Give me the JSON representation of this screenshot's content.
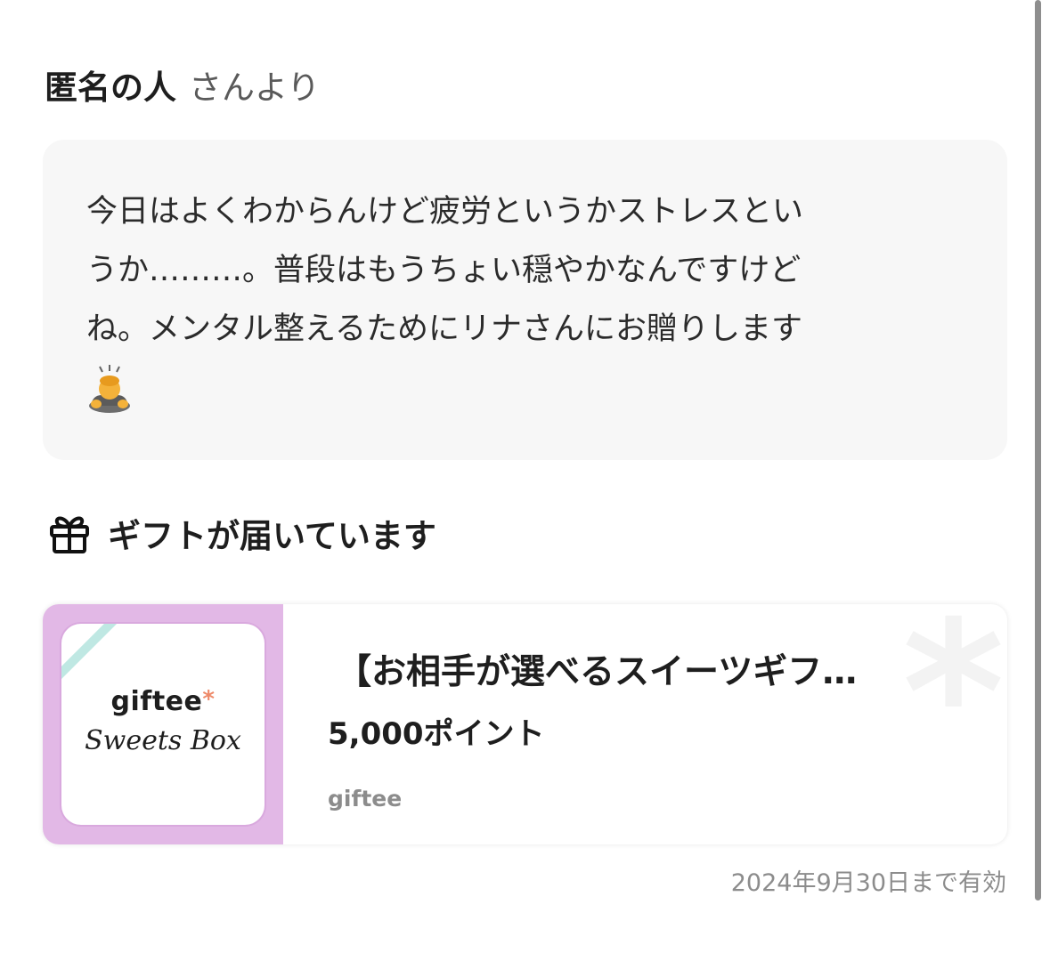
{
  "sender": {
    "name": "匿名の人",
    "suffix": "さんより"
  },
  "message": {
    "lines": [
      "今日はよくわからんけど疲労というかストレスとい",
      "うか………。普段はもうちょい穏やかなんですけど",
      "ね。メンタル整えるためにリナさんにお贈りします"
    ],
    "emoji": "person-bowing-emoji"
  },
  "gift_section": {
    "icon": "gift-icon",
    "label": "ギフトが届いています"
  },
  "gift_card": {
    "thumbnail": {
      "logo_text": "giftee",
      "logo_star": "*",
      "subtitle": "Sweets Box",
      "background_color": "#e2b8e6"
    },
    "title": "【お相手が選べるスイーツギフ…",
    "points": "5,000ポイント",
    "brand": "giftee"
  },
  "expiry": "2024年9月30日まで有効"
}
